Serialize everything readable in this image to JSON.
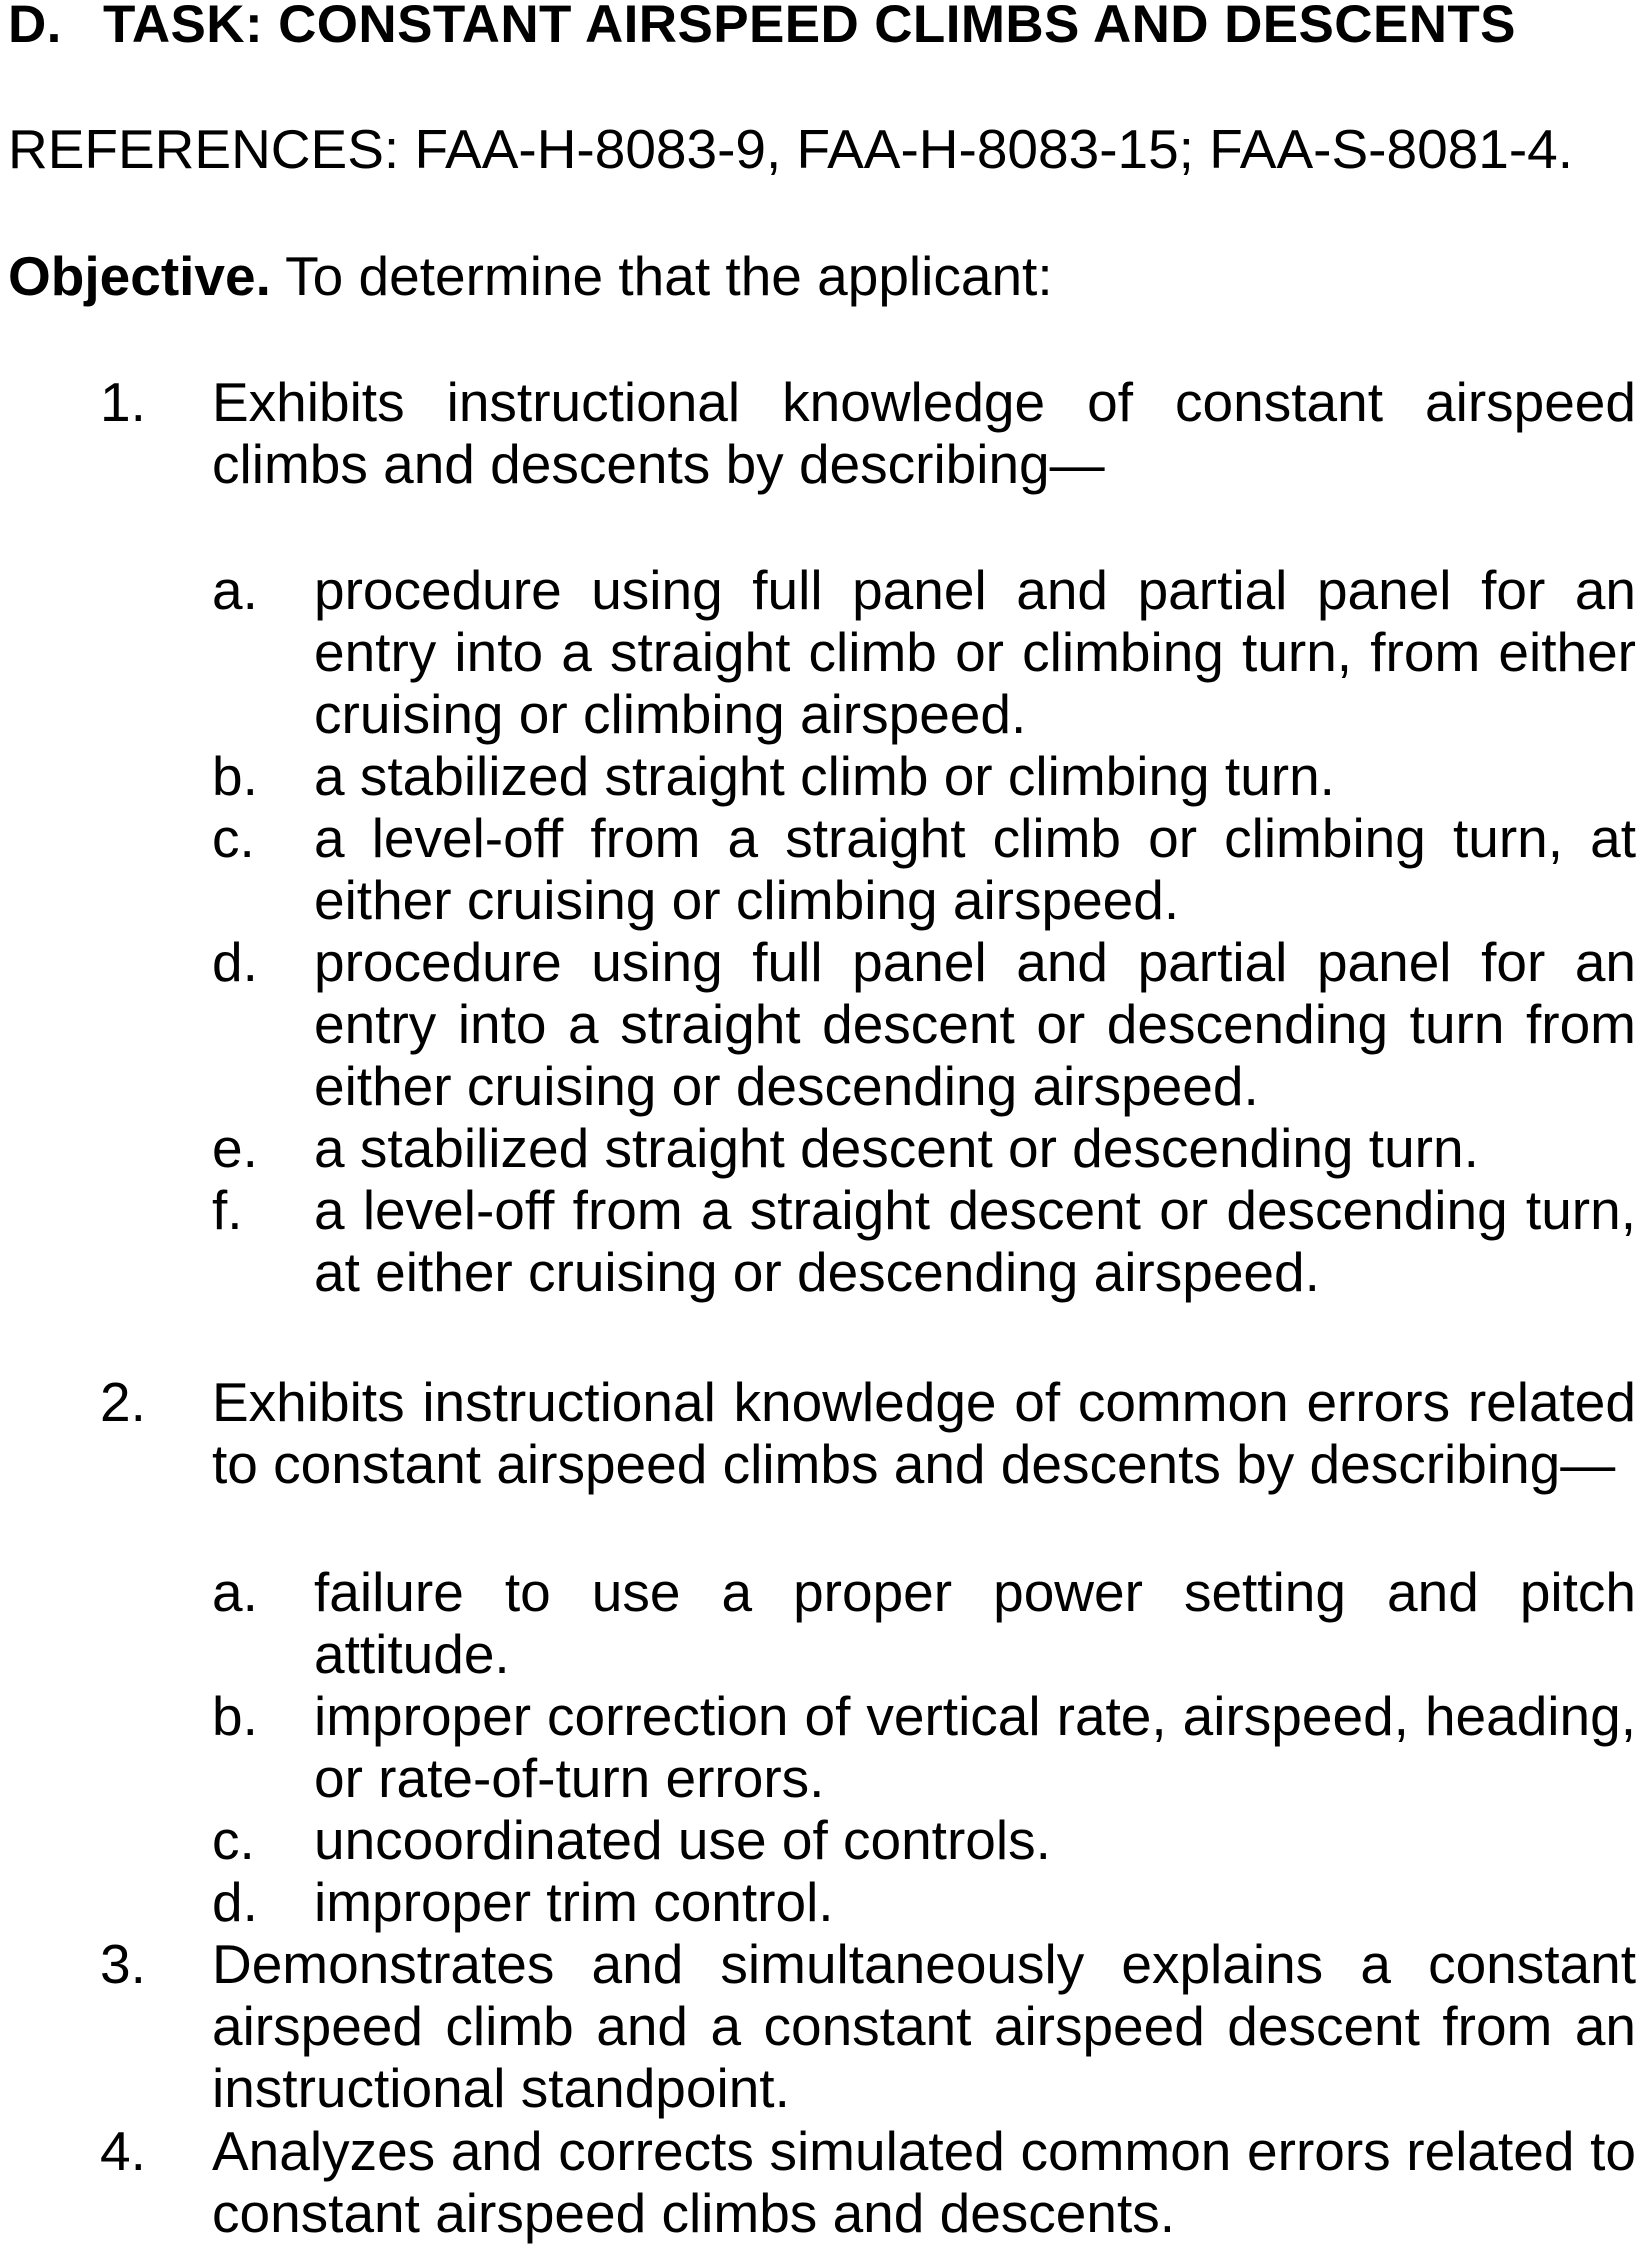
{
  "task": {
    "number": "D.",
    "title": "TASK: CONSTANT AIRSPEED CLIMBS AND DESCENTS"
  },
  "references": "REFERENCES: FAA-H-8083-9, FAA-H-8083-15; FAA-S-8081-4.",
  "objective": {
    "lead": "Objective.",
    "text": " To determine that the applicant:"
  },
  "items": [
    {
      "num": "1.",
      "text": "Exhibits instructional knowledge of constant airspeed climbs and descents by describing—",
      "subitems": [
        {
          "letter": "a.",
          "text": "procedure using full panel and partial panel for an entry into a straight climb or climbing turn, from either cruising or climbing airspeed."
        },
        {
          "letter": "b.",
          "text": "a stabilized straight climb or climbing turn."
        },
        {
          "letter": "c.",
          "text": "a level-off from a straight climb or climbing turn, at either cruising or climbing airspeed."
        },
        {
          "letter": "d.",
          "text": "procedure using full panel and partial panel for an entry into a straight descent or descending turn from either cruising or descending airspeed."
        },
        {
          "letter": "e.",
          "text": "a stabilized straight descent or descending turn."
        },
        {
          "letter": "f.",
          "text": "a level-off from a straight descent or descending turn, at either cruising or descending airspeed."
        }
      ]
    },
    {
      "num": "2.",
      "text": "Exhibits instructional knowledge of common errors related to constant airspeed climbs and descents by describing—",
      "subitems": [
        {
          "letter": "a.",
          "text": "failure to use a proper power setting and pitch attitude."
        },
        {
          "letter": "b.",
          "text": "improper correction of vertical rate, airspeed, heading, or rate-of-turn errors."
        },
        {
          "letter": "c.",
          "text": "uncoordinated use of controls."
        },
        {
          "letter": "d.",
          "text": "improper trim control."
        }
      ]
    },
    {
      "num": "3.",
      "text": "Demonstrates and simultaneously explains a constant airspeed climb and a constant airspeed descent from an instructional standpoint."
    },
    {
      "num": "4.",
      "text": "Analyzes and corrects simulated common errors related to constant airspeed climbs and descents."
    }
  ]
}
